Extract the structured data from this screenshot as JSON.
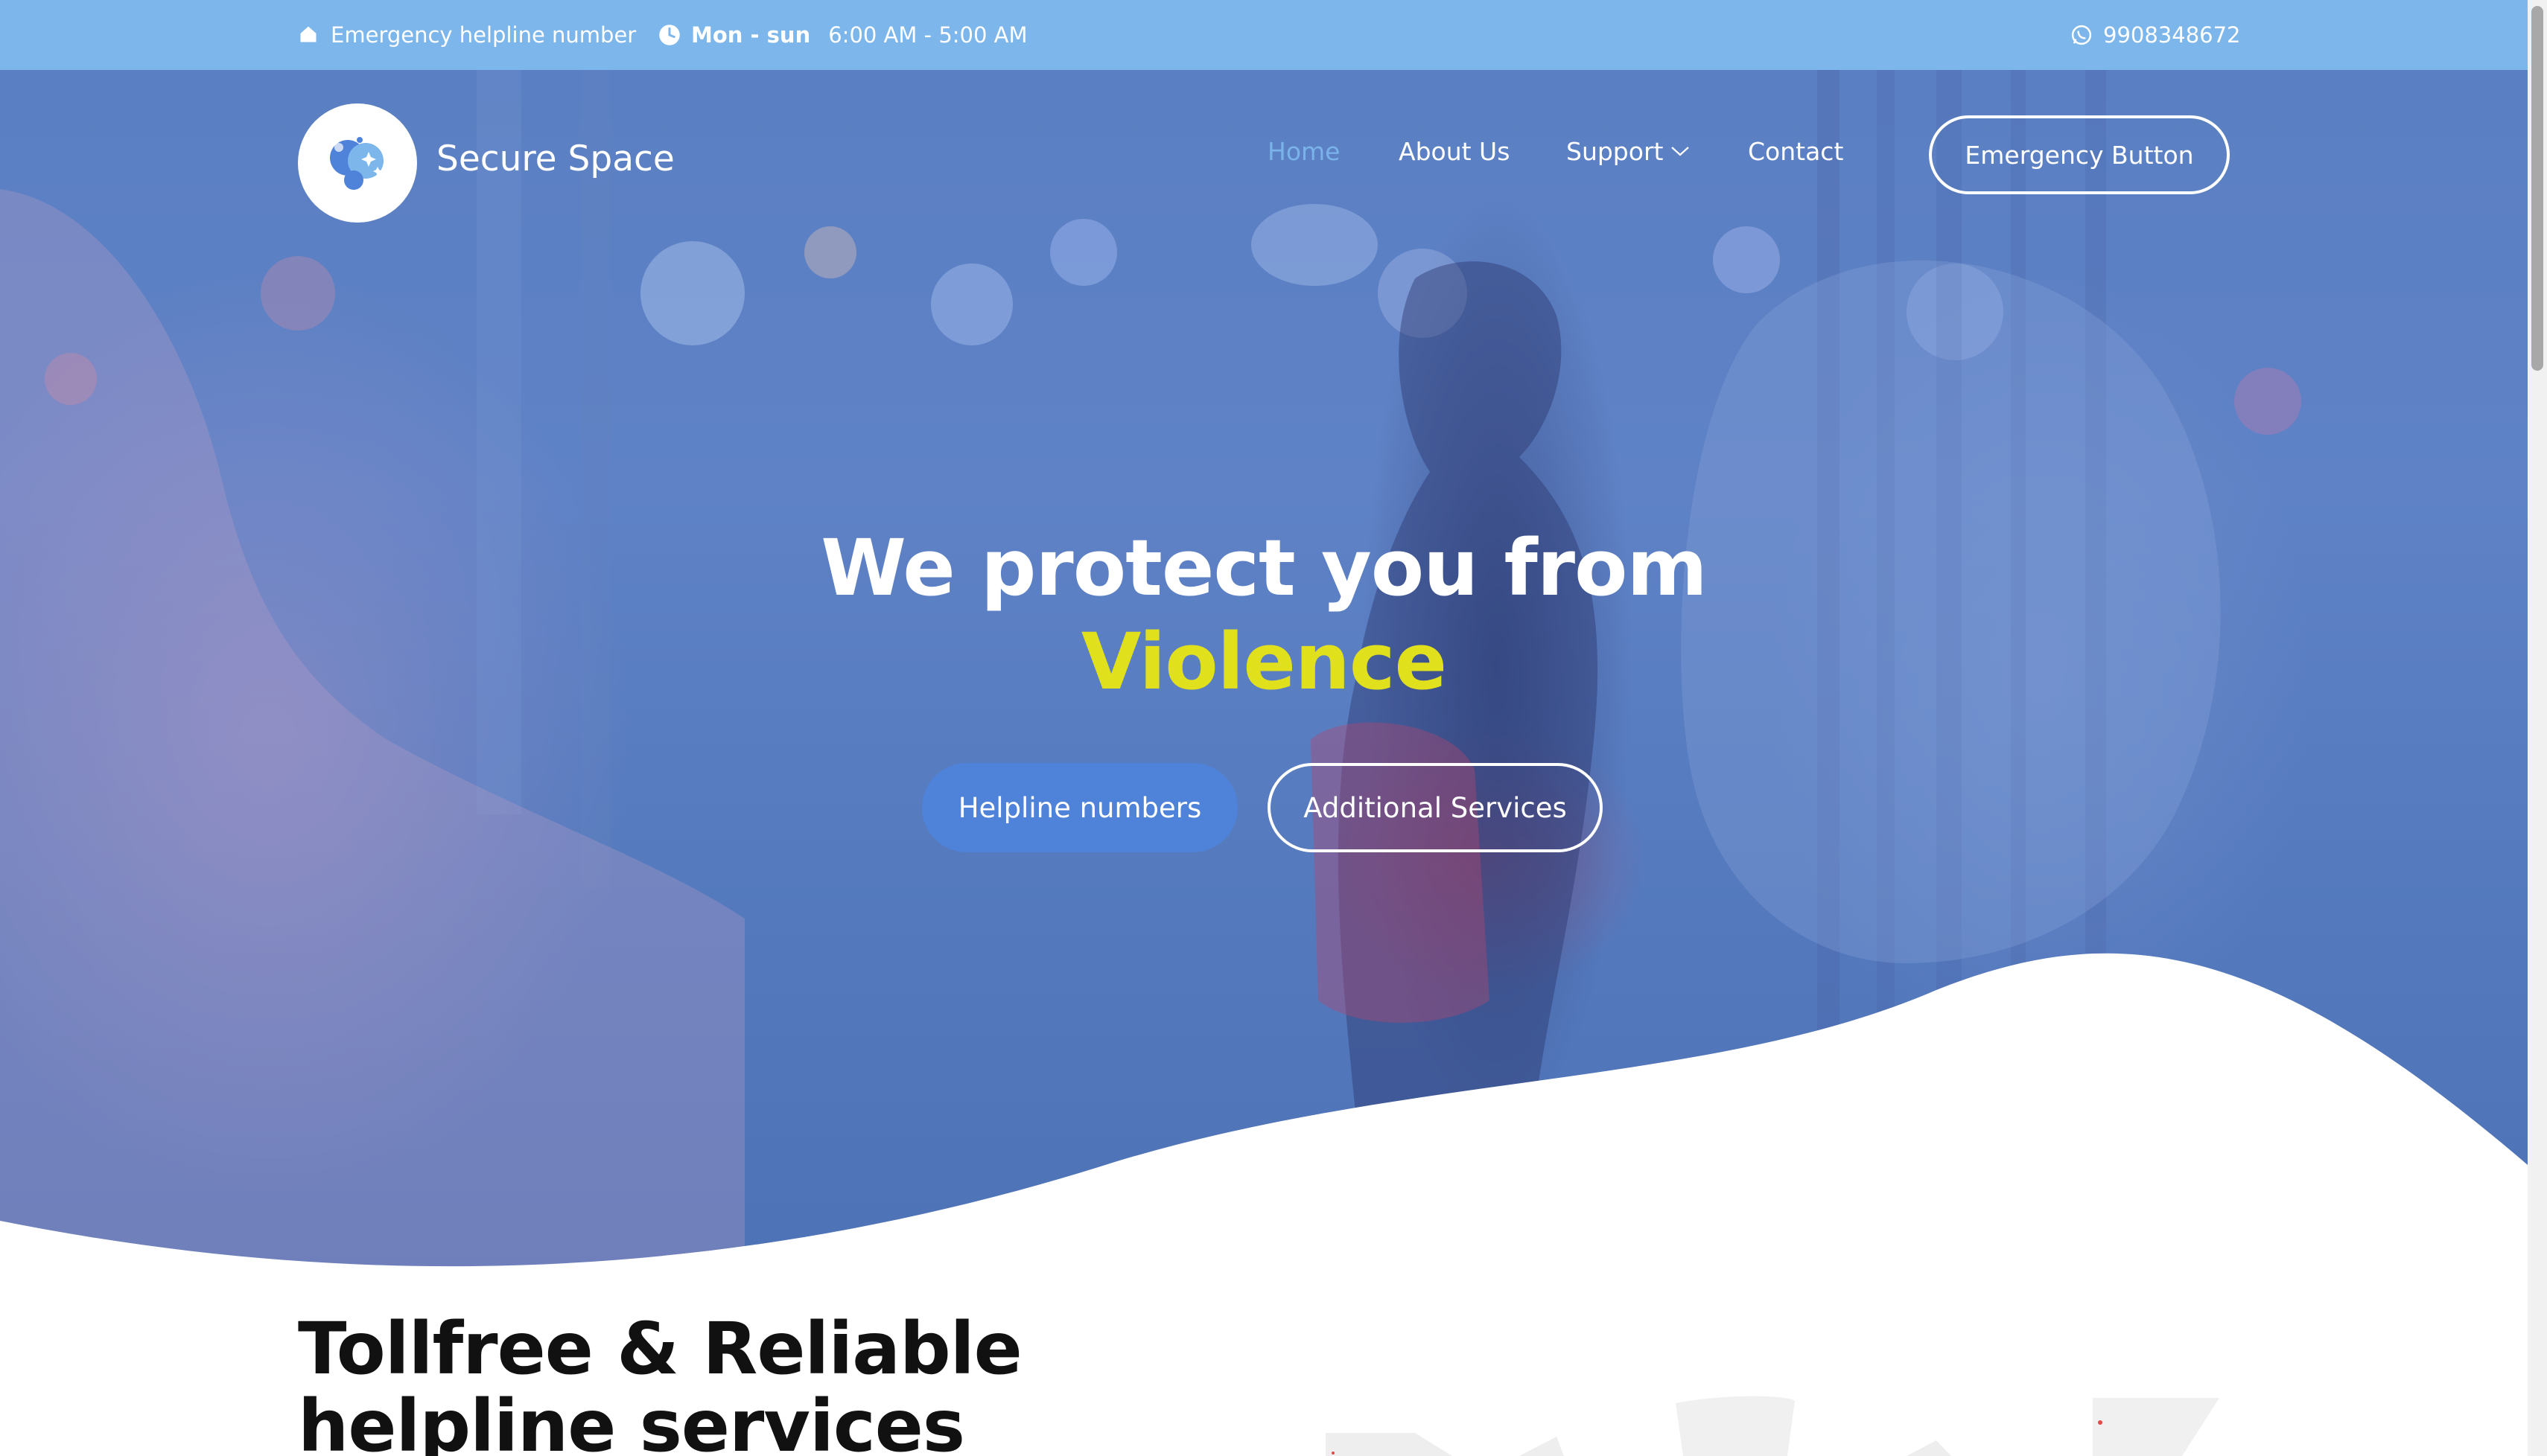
{
  "topbar": {
    "helpline_label": "Emergency helpline number",
    "hours_days": "Mon - sun",
    "hours_time": "6:00 AM - 5:00 AM",
    "phone": "9908348672",
    "icons": [
      "home-icon",
      "clock-icon",
      "whatsapp-icon"
    ]
  },
  "navbar": {
    "brand": "Secure Space",
    "links": [
      {
        "label": "Home",
        "active": true
      },
      {
        "label": "About Us",
        "active": false
      },
      {
        "label": "Support",
        "active": false,
        "dropdown": true
      },
      {
        "label": "Contact",
        "active": false
      }
    ],
    "cta": "Emergency Button"
  },
  "hero": {
    "headline_line1": "We protect you from",
    "headline_accent": "Violence",
    "primary_button": "Helpline numbers",
    "secondary_button": "Additional Services"
  },
  "section": {
    "title_line1": "Tollfree & Reliable",
    "title_line2": "helpline services"
  },
  "colors": {
    "topbar": "#7cb6ea",
    "active_link": "#7ab3ea",
    "accent_text": "#e1e01c",
    "primary_button": "#4f82d9",
    "hero_overlay": "#5a7fc2"
  }
}
